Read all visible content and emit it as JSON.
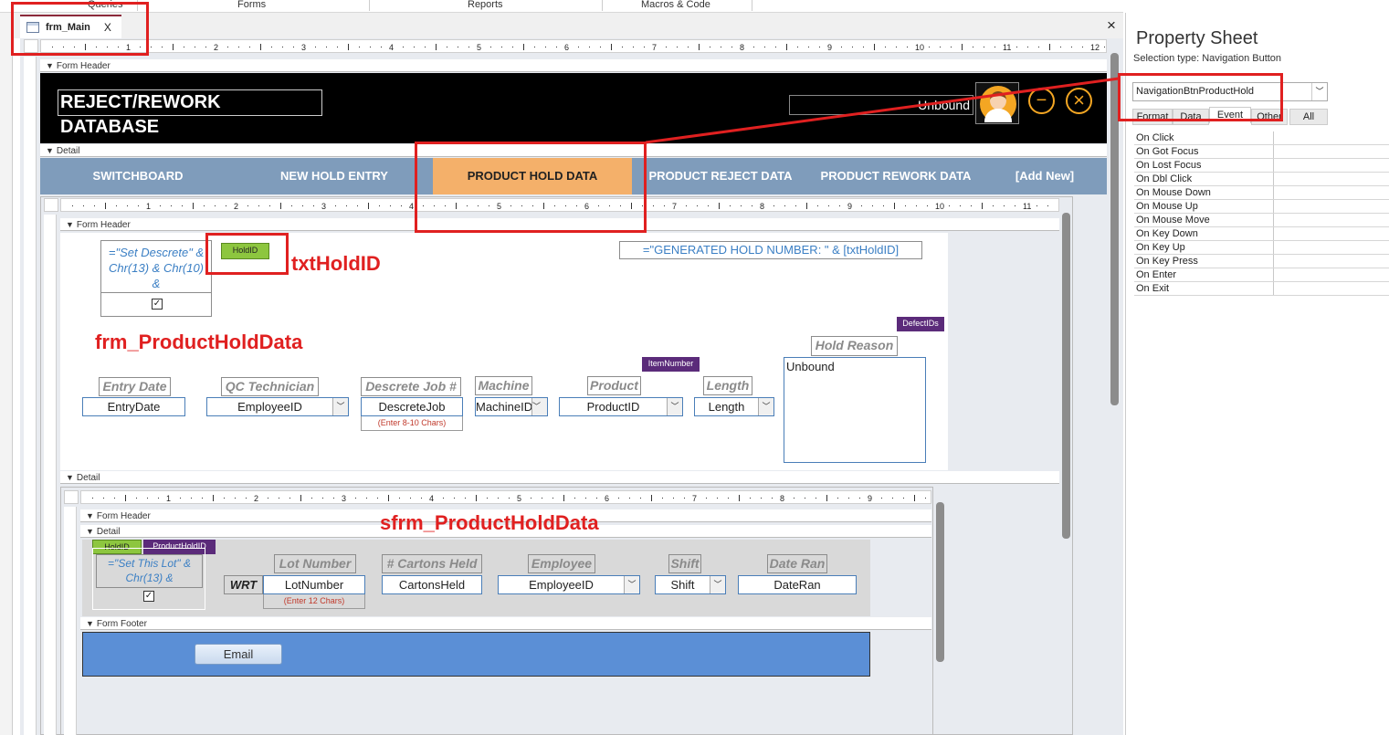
{
  "ribbon": {
    "groups": [
      "Queries",
      "Forms",
      "Reports",
      "Macros & Code"
    ]
  },
  "document_tab": {
    "label": "frm_Main",
    "close": "X"
  },
  "design_close": "×",
  "rulers": {
    "main": [
      "1",
      "2",
      "3",
      "4",
      "5",
      "6",
      "7",
      "8",
      "9",
      "10",
      "11",
      "12"
    ],
    "sub": [
      "1",
      "2",
      "3",
      "4",
      "5",
      "6",
      "7",
      "8",
      "9",
      "10",
      "11"
    ],
    "inner": [
      "1",
      "2",
      "3",
      "4",
      "5",
      "6",
      "7",
      "8",
      "9"
    ]
  },
  "main_form": {
    "form_header_label": "Form Header",
    "detail_label": "Detail",
    "title": "REJECT/REWORK DATABASE",
    "unbound_box": "Unbound",
    "minimize_glyph": "−",
    "close_glyph": "×",
    "nav_buttons": [
      "SWITCHBOARD",
      "NEW HOLD ENTRY",
      "PRODUCT HOLD DATA",
      "PRODUCT REJECT DATA",
      "PRODUCT REWORK DATA",
      "[Add New]"
    ],
    "active_color": "#f4b06a",
    "nav_color": "#7f9cbb"
  },
  "subform": {
    "form_header_label": "Form Header",
    "detail_label": "Detail",
    "set_descrete_expr": "=\"Set Descrete\" & Chr(13) & Chr(10) &",
    "hold_id_tag": "HoldID",
    "generated_expr": "=\"GENERATED HOLD NUMBER: \" & [txtHoldID]",
    "defect_ids_tag": "DefectIDs",
    "item_number_tag": "ItemNumber",
    "labels": {
      "entry_date": "Entry Date",
      "qc_technician": "QC Technician",
      "descrete_job": "Descrete Job #",
      "machine": "Machine",
      "product": "Product",
      "length": "Length",
      "hold_reason": "Hold Reason"
    },
    "fields": {
      "entry_date": "EntryDate",
      "employee_id": "EmployeeID",
      "descrete_job": "DescreteJob",
      "machine_id": "MachineID",
      "product_id": "ProductID",
      "length": "Length",
      "hold_reason": "Unbound"
    },
    "descrete_note": "(Enter 8-10 Chars)"
  },
  "inner_subform": {
    "form_header_label": "Form Header",
    "detail_label": "Detail",
    "form_footer_label": "Form Footer",
    "hold_id_tag": "HoldID",
    "product_hold_id_tag": "ProductHoldID",
    "set_lot_expr": "=\"Set This Lot\" & Chr(13) &",
    "wrt_label": "WRT",
    "labels": {
      "lot_number": "Lot Number",
      "cartons_held": "# Cartons Held",
      "employee": "Employee",
      "shift": "Shift",
      "date_ran": "Date Ran"
    },
    "fields": {
      "lot_number": "LotNumber",
      "cartons_held": "CartonsHeld",
      "employee_id": "EmployeeID",
      "shift": "Shift",
      "date_ran": "DateRan"
    },
    "lot_note": "(Enter 12 Chars)",
    "email_button": "Email"
  },
  "annotations": {
    "txt_hold_id": "txtHoldID",
    "frm_product_hold_data": "frm_ProductHoldData",
    "sfrm_product_hold_data": "sfrm_ProductHoldData"
  },
  "property_sheet": {
    "title": "Property Sheet",
    "selection_type": "Selection type:  Navigation Button",
    "selected_object": "NavigationBtnProductHold",
    "tabs": [
      "Format",
      "Data",
      "Event",
      "Other",
      "All"
    ],
    "active_tab": "Event",
    "properties": [
      "On Click",
      "On Got Focus",
      "On Lost Focus",
      "On Dbl Click",
      "On Mouse Down",
      "On Mouse Up",
      "On Mouse Move",
      "On Key Down",
      "On Key Up",
      "On Key Press",
      "On Enter",
      "On Exit"
    ]
  }
}
